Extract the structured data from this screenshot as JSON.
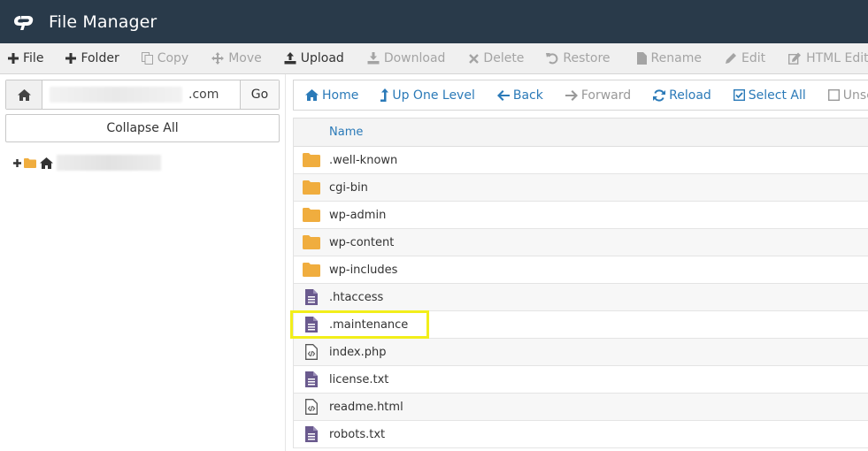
{
  "header": {
    "title": "File Manager"
  },
  "toolbar": {
    "file": "File",
    "folder": "Folder",
    "copy": "Copy",
    "move": "Move",
    "upload": "Upload",
    "download": "Download",
    "delete": "Delete",
    "restore": "Restore",
    "rename": "Rename",
    "edit": "Edit",
    "html_editor": "HTML Editor"
  },
  "left": {
    "path_suffix": ".com",
    "go_label": "Go",
    "collapse_label": "Collapse All"
  },
  "nav": {
    "home": "Home",
    "up_one_level": "Up One Level",
    "back": "Back",
    "forward": "Forward",
    "reload": "Reload",
    "select_all": "Select All",
    "unselect": "Unselect"
  },
  "table": {
    "header_name": "Name",
    "rows": [
      {
        "name": ".well-known",
        "type": "folder"
      },
      {
        "name": "cgi-bin",
        "type": "folder"
      },
      {
        "name": "wp-admin",
        "type": "folder"
      },
      {
        "name": "wp-content",
        "type": "folder"
      },
      {
        "name": "wp-includes",
        "type": "folder"
      },
      {
        "name": ".htaccess",
        "type": "text"
      },
      {
        "name": ".maintenance",
        "type": "text"
      },
      {
        "name": "index.php",
        "type": "code"
      },
      {
        "name": "license.txt",
        "type": "text"
      },
      {
        "name": "readme.html",
        "type": "code"
      },
      {
        "name": "robots.txt",
        "type": "text"
      }
    ]
  },
  "colors": {
    "header_bg": "#293a4a",
    "link_blue": "#2b7ab8",
    "folder": "#f0ad3e",
    "file_purple": "#6a5a8e",
    "highlight": "#f2ee1a"
  }
}
